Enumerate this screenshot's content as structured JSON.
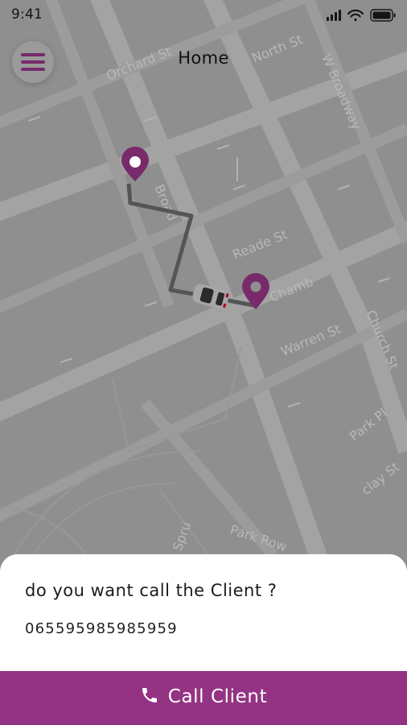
{
  "status_bar": {
    "time": "9:41",
    "icons": [
      "signal-icon",
      "wifi-icon",
      "battery-icon"
    ]
  },
  "header": {
    "title": "Home",
    "menu_icon": "hamburger-menu-icon"
  },
  "map": {
    "streets": [
      "Orchard St",
      "North St",
      "W Broadway",
      "Broad",
      "Reade St",
      "Chamb",
      "Warren St",
      "Church St",
      "Park Pl",
      "clay St",
      "Park Row",
      "Spru"
    ],
    "pin_icons": [
      "location-pin-icon",
      "location-pin-icon"
    ],
    "car_icon": "car-icon"
  },
  "dialog": {
    "question": "do you want call the Client ?",
    "phone": "065595985985959"
  },
  "call_button": {
    "label": "Call Client",
    "icon": "phone-icon"
  },
  "colors": {
    "accent": "#943383",
    "overlay_map": "#8f8f8f",
    "sheet_bg": "#ffffff"
  }
}
